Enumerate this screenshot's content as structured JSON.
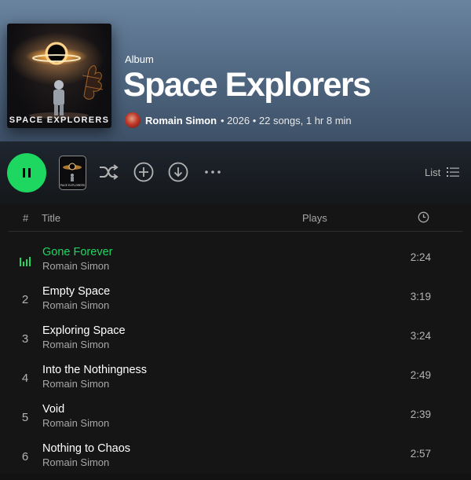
{
  "album": {
    "cover_text": "SPACE EXPLORERS",
    "type_label": "Album",
    "title": "Space Explorers",
    "artist": "Romain Simon",
    "meta": "• 2026 • 22 songs, 1 hr 8 min"
  },
  "controls": {
    "play_state": "pause-icon",
    "mini_cover_text": "SPACE EXPLORERS",
    "view_label": "List"
  },
  "table": {
    "columns": {
      "number": "#",
      "title": "Title",
      "plays": "Plays",
      "duration": "clock-icon"
    },
    "tracks": [
      {
        "number": "1",
        "title": "Gone Forever",
        "artist": "Romain Simon",
        "duration": "2:24",
        "playing": true
      },
      {
        "number": "2",
        "title": "Empty Space",
        "artist": "Romain Simon",
        "duration": "3:19"
      },
      {
        "number": "3",
        "title": "Exploring Space",
        "artist": "Romain Simon",
        "duration": "3:24"
      },
      {
        "number": "4",
        "title": "Into the Nothingness",
        "artist": "Romain Simon",
        "duration": "2:49"
      },
      {
        "number": "5",
        "title": "Void",
        "artist": "Romain Simon",
        "duration": "2:39"
      },
      {
        "number": "6",
        "title": "Nothing to Chaos",
        "artist": "Romain Simon",
        "duration": "2:57"
      }
    ]
  },
  "colors": {
    "accent": "#1ed760",
    "header": "#5b7490",
    "background": "#121212"
  }
}
